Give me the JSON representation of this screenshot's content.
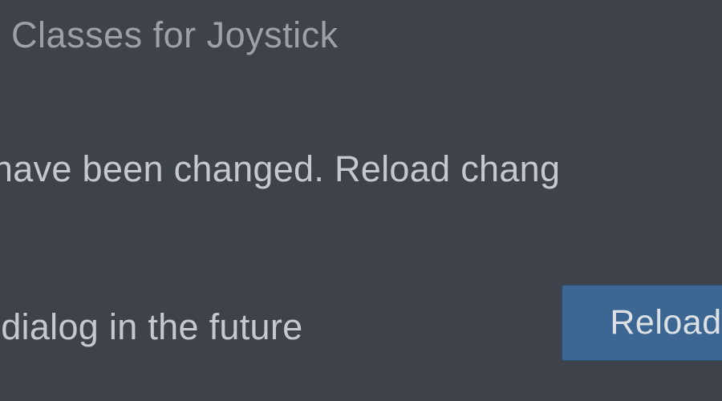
{
  "dialog": {
    "title": "ed Classes for Joystick",
    "message": "es have been changed. Reload chang",
    "checkbox_label": "his dialog in the future",
    "reload_button": "Reload"
  }
}
